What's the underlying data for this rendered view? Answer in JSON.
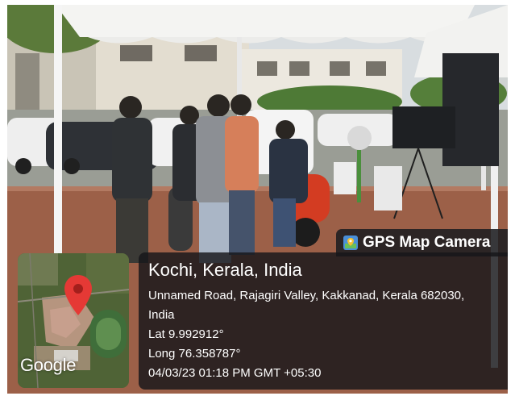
{
  "overlay": {
    "app_name": "GPS Map Camera",
    "app_icon": "map-pin-app-icon",
    "map_provider": "Google",
    "map_pin_icon": "location-pin-icon",
    "pin_color": "#e53935",
    "location_title": "Kochi, Kerala, India",
    "address_line_1": "Unnamed Road, Rajagiri Valley, Kakkanad, Kerala 682030,",
    "address_line_2": "India",
    "latitude": "Lat 9.992912°",
    "longitude": "Long 76.358787°",
    "datetime": "04/03/23 01:18 PM GMT +05:30"
  }
}
